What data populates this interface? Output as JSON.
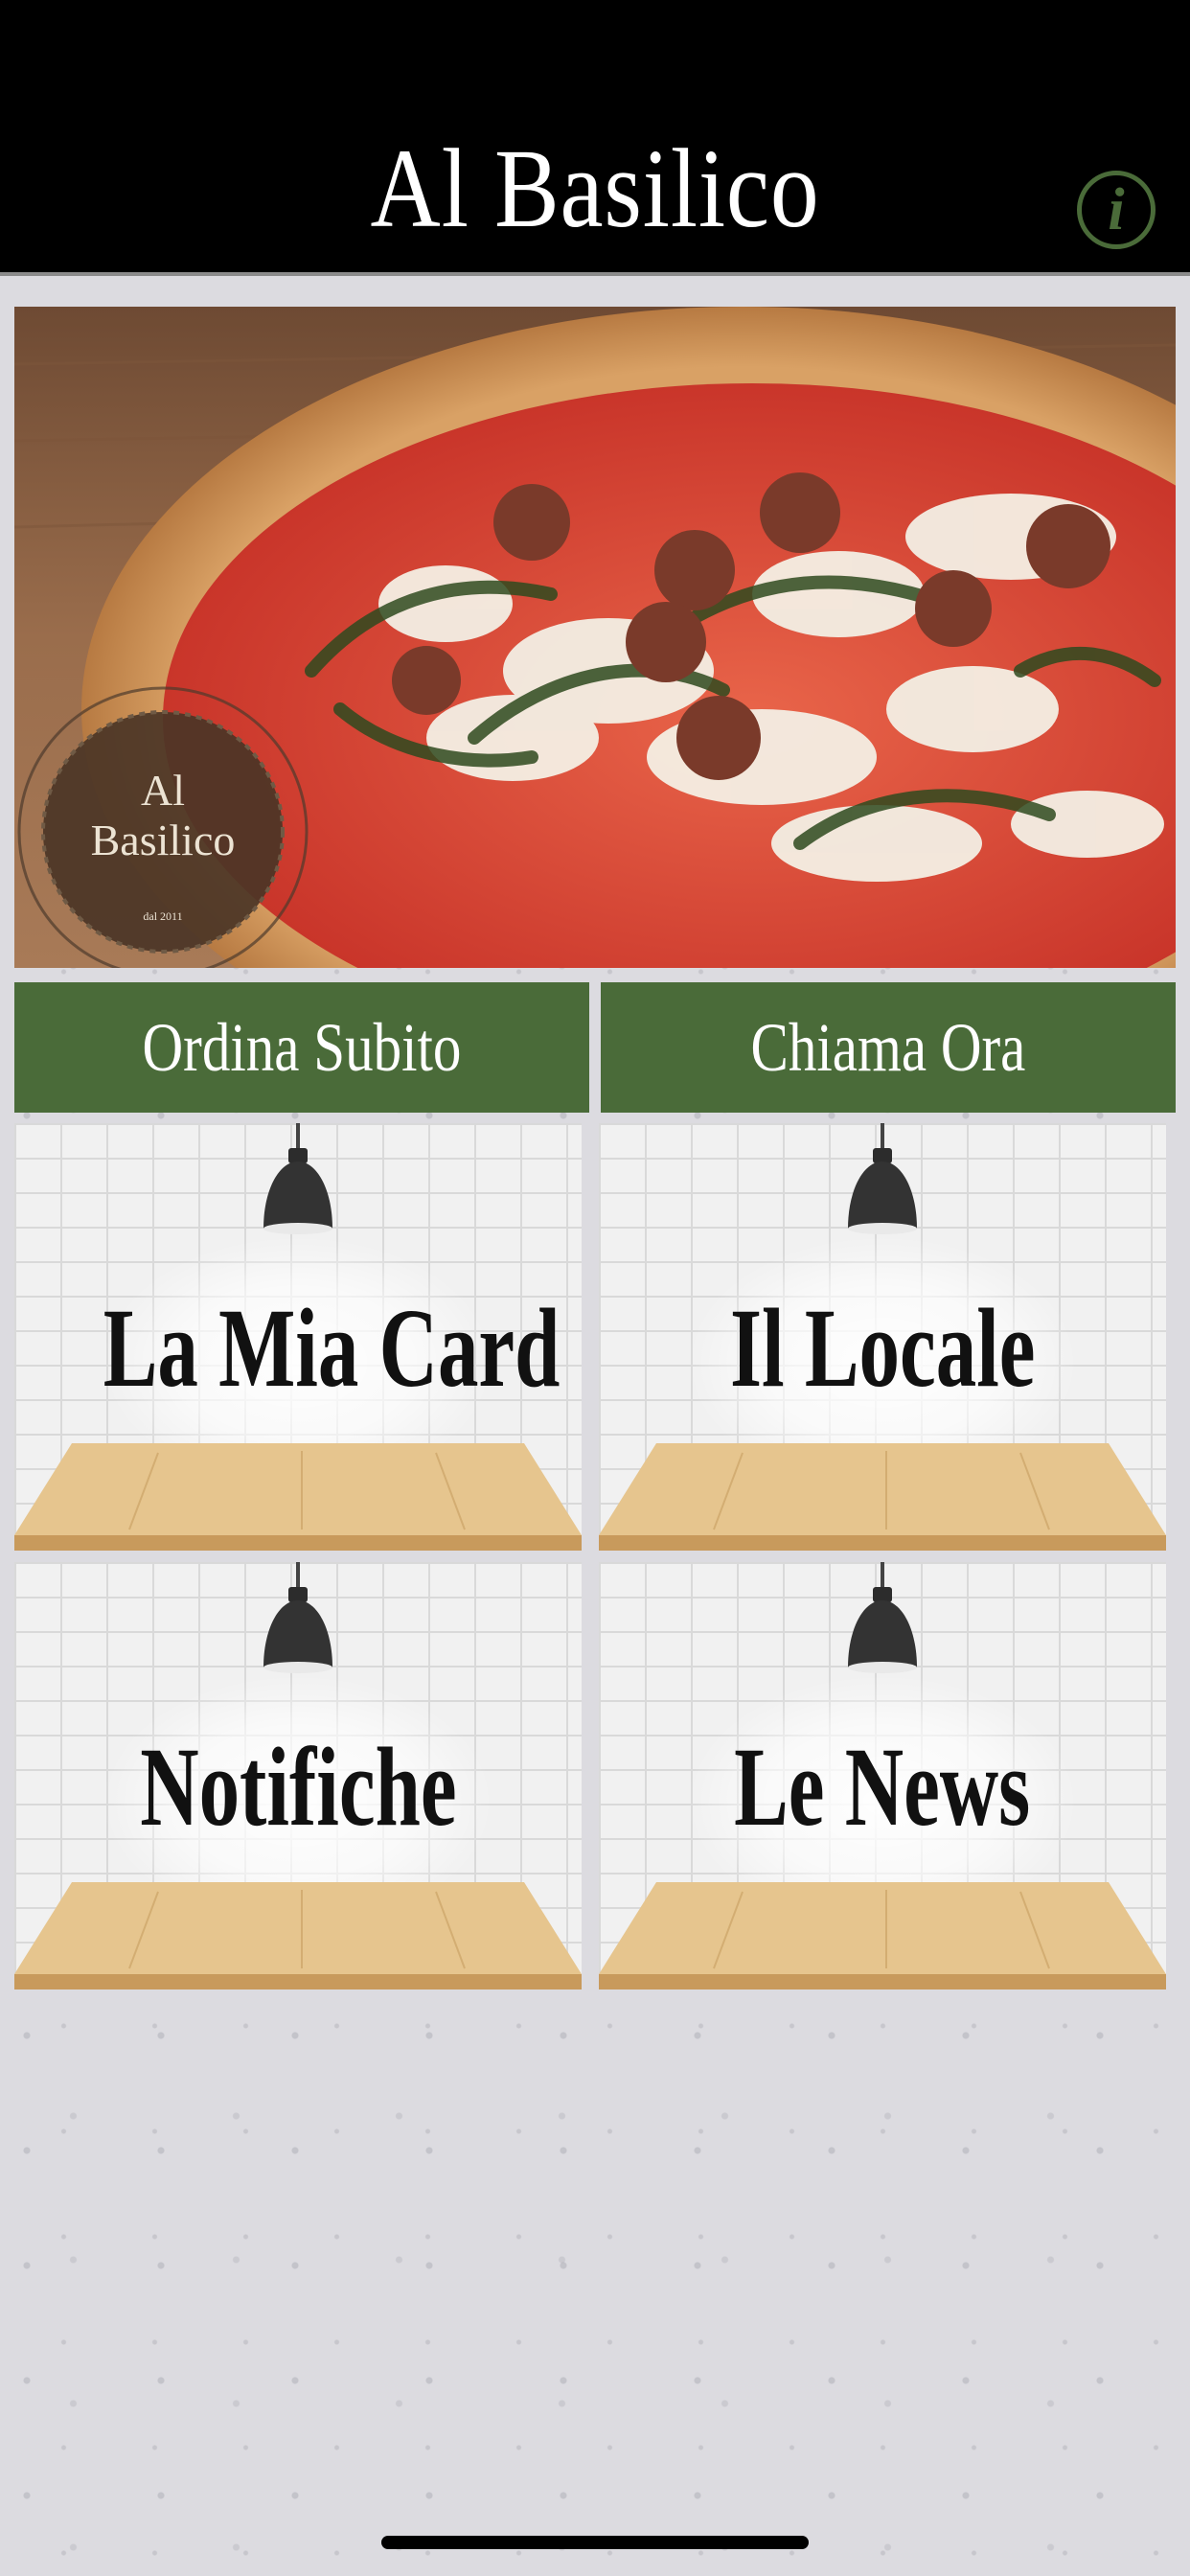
{
  "header": {
    "title": "Al Basilico",
    "info_label": "i"
  },
  "hero": {
    "image": "pizza-photo",
    "logo_line1": "Al",
    "logo_line2": "Basilico",
    "logo_est": "dal 2011"
  },
  "actions": {
    "order_label": "Ordina Subito",
    "call_label": "Chiama Ora"
  },
  "tiles": [
    {
      "label": "La Mia Card"
    },
    {
      "label": "Il Locale"
    },
    {
      "label": "Notifiche"
    },
    {
      "label": "Le News"
    }
  ],
  "colors": {
    "header_bg": "#000000",
    "accent_green": "#4a6b39",
    "page_bg": "#dcdbe0"
  }
}
